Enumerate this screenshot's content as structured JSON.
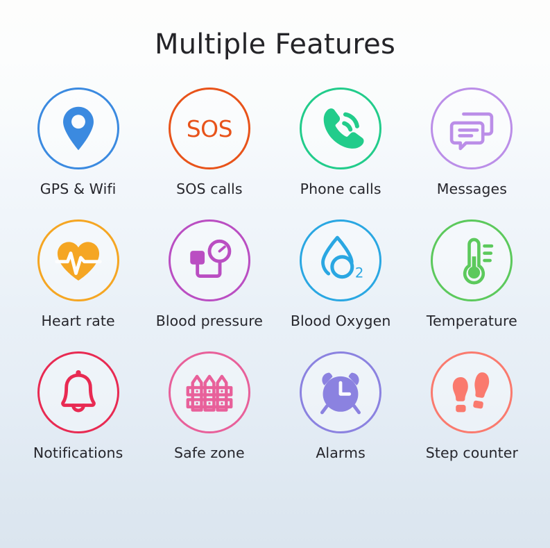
{
  "header": {
    "title": "Multiple Features"
  },
  "theme": {
    "background_top": "#fdfdfc",
    "background_bottom": "#dbe5ef",
    "title_color": "#242428",
    "label_color": "#26262c"
  },
  "grid": {
    "columns": 4,
    "rows": 3,
    "items": [
      {
        "label": "GPS & Wifi",
        "icon": "map-pin-icon",
        "color": "#3b8ae0"
      },
      {
        "label": "SOS calls",
        "icon": "sos-text-icon",
        "color": "#e8531a",
        "icon_text": "SOS"
      },
      {
        "label": "Phone calls",
        "icon": "phone-call-icon",
        "color": "#22cc8b"
      },
      {
        "label": "Messages",
        "icon": "chat-bubbles-icon",
        "color": "#bb8ee8"
      },
      {
        "label": "Heart rate",
        "icon": "heart-pulse-icon",
        "color": "#f5a623"
      },
      {
        "label": "Blood pressure",
        "icon": "blood-pressure-cuff-icon",
        "color": "#ba4ec2"
      },
      {
        "label": "Blood Oxygen",
        "icon": "water-drop-o2-icon",
        "color": "#2aa7e2",
        "icon_text": "O2"
      },
      {
        "label": "Temperature",
        "icon": "thermometer-icon",
        "color": "#5cc95c"
      },
      {
        "label": "Notifications",
        "icon": "bell-icon",
        "color": "#e82a52"
      },
      {
        "label": "Safe zone",
        "icon": "fence-icon",
        "color": "#e8609a"
      },
      {
        "label": "Alarms",
        "icon": "alarm-clock-icon",
        "color": "#8b82e0"
      },
      {
        "label": "Step counter",
        "icon": "footprints-icon",
        "color": "#fa7a6e"
      }
    ]
  }
}
